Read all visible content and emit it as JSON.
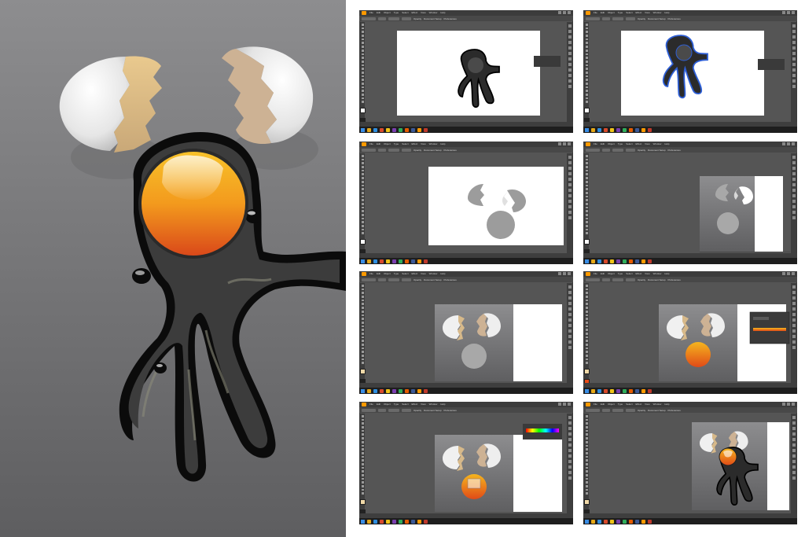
{
  "app": {
    "menus": [
      "File",
      "Edit",
      "Object",
      "Type",
      "Select",
      "Effect",
      "View",
      "Window",
      "Help"
    ],
    "control_bar": [
      "Opacity",
      "Document Setup",
      "Preferences"
    ]
  },
  "colors": {
    "background_gray": "#8a8a8a",
    "shell_white": "#f4f4f4",
    "shell_crack": "#d7b98a",
    "yolk_top": "#f5b51e",
    "yolk_bottom": "#e04a17",
    "egg_white_outline": "#0a0a0a",
    "egg_white_fill": "#3a3a3a",
    "ui_dark": "#555555",
    "artboard": "#ffffff",
    "taskbar": "#1e1e1e",
    "illustrator_logo": "#ff9a00"
  },
  "icons": [
    "windows-start-icon",
    "illustrator-logo-icon",
    "tool-icon",
    "panel-icon"
  ],
  "steps": [
    {
      "id": "step-1",
      "stage": "egg-white-sketch"
    },
    {
      "id": "step-2",
      "stage": "egg-white-path-selected"
    },
    {
      "id": "step-3",
      "stage": "gray-base-shapes"
    },
    {
      "id": "step-4",
      "stage": "gradient-background"
    },
    {
      "id": "step-5",
      "stage": "shell-colors"
    },
    {
      "id": "step-6",
      "stage": "yolk-gradient"
    },
    {
      "id": "step-7",
      "stage": "yolk-highlight"
    },
    {
      "id": "step-8",
      "stage": "final-assembly"
    }
  ]
}
